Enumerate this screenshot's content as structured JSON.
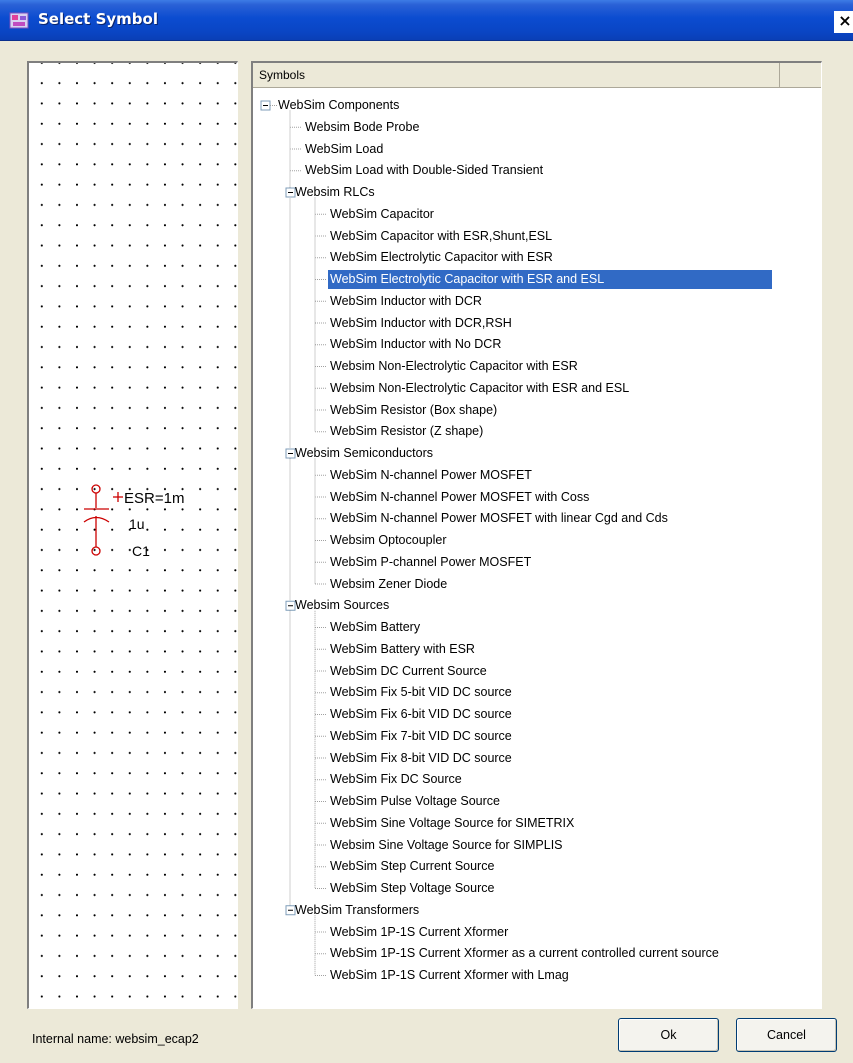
{
  "window": {
    "title": "Select Symbol",
    "close_label": "×"
  },
  "preview": {
    "symbol_labels": {
      "esr": "ESR=1m",
      "value": "1u",
      "ref": "C1",
      "plus": "+"
    }
  },
  "tree": {
    "column_header": "Symbols",
    "selected_label": "WebSim Electrolytic Capacitor with ESR and ESL",
    "nodes": [
      {
        "label": "WebSim Components",
        "level": 0,
        "expanded": true
      },
      {
        "label": "Websim Bode Probe",
        "level": 1
      },
      {
        "label": "WebSim Load",
        "level": 1
      },
      {
        "label": "WebSim Load with Double-Sided Transient",
        "level": 1
      },
      {
        "label": "Websim RLCs",
        "level": 1,
        "expanded": true
      },
      {
        "label": "WebSim Capacitor",
        "level": 2
      },
      {
        "label": "WebSim Capacitor with ESR,Shunt,ESL",
        "level": 2
      },
      {
        "label": "WebSim Electrolytic Capacitor with ESR",
        "level": 2
      },
      {
        "label": "WebSim Electrolytic Capacitor with ESR and ESL",
        "level": 2,
        "selected": true
      },
      {
        "label": "WebSim Inductor with DCR",
        "level": 2
      },
      {
        "label": "WebSim Inductor with DCR,RSH",
        "level": 2
      },
      {
        "label": "WebSim Inductor with No DCR",
        "level": 2
      },
      {
        "label": "Websim Non-Electrolytic Capacitor with ESR",
        "level": 2
      },
      {
        "label": "Websim Non-Electrolytic Capacitor with ESR and ESL",
        "level": 2
      },
      {
        "label": "WebSim Resistor (Box shape)",
        "level": 2
      },
      {
        "label": "WebSim Resistor (Z shape)",
        "level": 2
      },
      {
        "label": "Websim Semiconductors",
        "level": 1,
        "expanded": true
      },
      {
        "label": "WebSim N-channel Power MOSFET",
        "level": 2
      },
      {
        "label": "WebSim N-channel Power MOSFET with Coss",
        "level": 2
      },
      {
        "label": "WebSim N-channel Power MOSFET with linear Cgd and Cds",
        "level": 2
      },
      {
        "label": "Websim Optocoupler",
        "level": 2
      },
      {
        "label": "WebSim P-channel Power MOSFET",
        "level": 2
      },
      {
        "label": "Websim Zener Diode",
        "level": 2
      },
      {
        "label": "Websim Sources",
        "level": 1,
        "expanded": true
      },
      {
        "label": "WebSim Battery",
        "level": 2
      },
      {
        "label": "WebSim Battery with ESR",
        "level": 2
      },
      {
        "label": "WebSim DC Current Source",
        "level": 2
      },
      {
        "label": "WebSim Fix 5-bit VID DC source",
        "level": 2
      },
      {
        "label": "WebSim Fix 6-bit VID DC source",
        "level": 2
      },
      {
        "label": "WebSim Fix 7-bit VID DC source",
        "level": 2
      },
      {
        "label": "WebSim Fix 8-bit VID DC source",
        "level": 2
      },
      {
        "label": "WebSim Fix DC Source",
        "level": 2
      },
      {
        "label": "WebSim Pulse Voltage Source",
        "level": 2
      },
      {
        "label": "WebSim Sine Voltage Source for SIMETRIX",
        "level": 2
      },
      {
        "label": "Websim Sine Voltage Source for SIMPLIS",
        "level": 2
      },
      {
        "label": "WebSim Step Current Source",
        "level": 2
      },
      {
        "label": "WebSim Step Voltage Source",
        "level": 2
      },
      {
        "label": "WebSim Transformers",
        "level": 1,
        "expanded": true
      },
      {
        "label": "WebSim 1P-1S Current Xformer",
        "level": 2
      },
      {
        "label": "WebSim 1P-1S Current Xformer as a current controlled current source",
        "level": 2
      },
      {
        "label": "WebSim 1P-1S Current Xformer with Lmag",
        "level": 2
      }
    ]
  },
  "footer": {
    "internal_name": "Internal name: websim_ecap2",
    "ok_label": "Ok",
    "cancel_label": "Cancel"
  },
  "colors": {
    "title_bar": "#0a4cd0",
    "selection": "#316ac5",
    "symbol_red": "#cc0000",
    "dialog_bg": "#ece9d8"
  }
}
